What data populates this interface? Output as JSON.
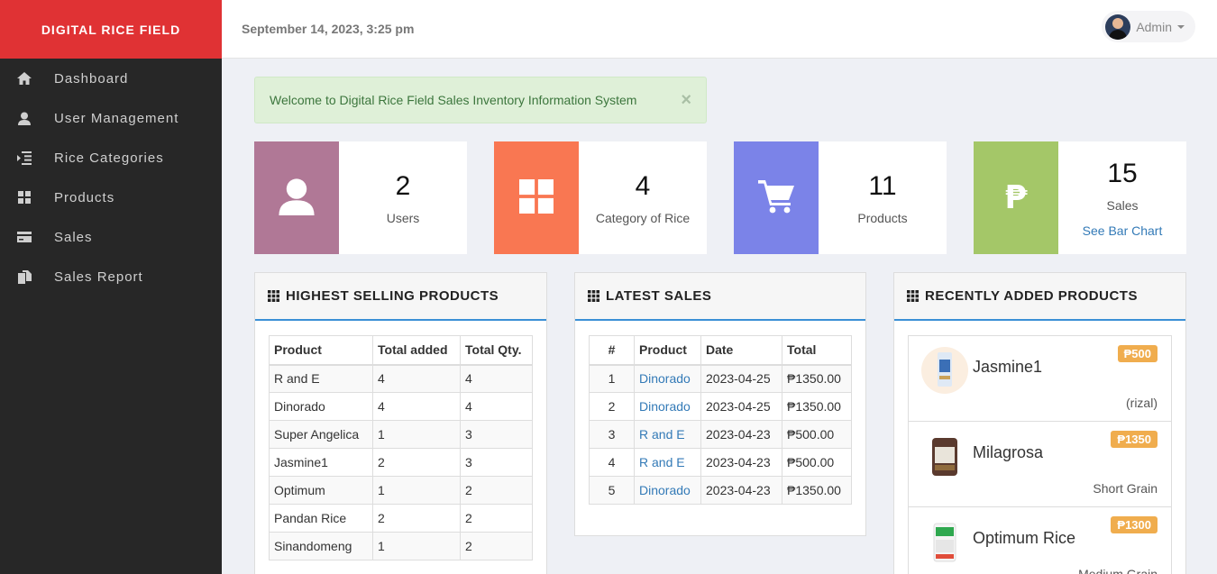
{
  "brand": "DIGITAL RICE FIELD",
  "header": {
    "date": "September 14, 2023, 3:25 pm",
    "user": "Admin"
  },
  "sidebar": {
    "items": [
      {
        "label": "Dashboard",
        "icon": "home-icon"
      },
      {
        "label": "User Management",
        "icon": "user-icon"
      },
      {
        "label": "Rice Categories",
        "icon": "indent-icon"
      },
      {
        "label": "Products",
        "icon": "th-large-icon"
      },
      {
        "label": "Sales",
        "icon": "credit-card-icon"
      },
      {
        "label": "Sales Report",
        "icon": "duplicate-icon"
      }
    ]
  },
  "alert": {
    "message": "Welcome to Digital Rice Field Sales Inventory Information System",
    "close": "×"
  },
  "stats": [
    {
      "value": "2",
      "label": "Users",
      "color": "#b07896",
      "icon": "user-icon"
    },
    {
      "value": "4",
      "label": "Category of Rice",
      "color": "#f97752",
      "icon": "th-large-icon"
    },
    {
      "value": "11",
      "label": "Products",
      "color": "#7b83e8",
      "icon": "shopping-cart-icon"
    },
    {
      "value": "15",
      "label": "Sales",
      "color": "#a4c768",
      "icon": "peso-icon",
      "symbol": "₱",
      "link": "See Bar Chart"
    }
  ],
  "highest_selling": {
    "title": "HIGHEST SELLING PRODUCTS",
    "columns": [
      "Product",
      "Total added",
      "Total Qty."
    ],
    "rows": [
      [
        "R and E",
        "4",
        "4"
      ],
      [
        "Dinorado",
        "4",
        "4"
      ],
      [
        "Super Angelica",
        "1",
        "3"
      ],
      [
        "Jasmine1",
        "2",
        "3"
      ],
      [
        "Optimum",
        "1",
        "2"
      ],
      [
        "Pandan Rice",
        "2",
        "2"
      ],
      [
        "Sinandomeng",
        "1",
        "2"
      ]
    ]
  },
  "latest_sales": {
    "title": "LATEST SALES",
    "columns": [
      "#",
      "Product",
      "Date",
      "Total"
    ],
    "rows": [
      [
        "1",
        "Dinorado",
        "2023-04-25",
        "₱1350.00"
      ],
      [
        "2",
        "Dinorado",
        "2023-04-25",
        "₱1350.00"
      ],
      [
        "3",
        "R and E",
        "2023-04-23",
        "₱500.00"
      ],
      [
        "4",
        "R and E",
        "2023-04-23",
        "₱500.00"
      ],
      [
        "5",
        "Dinorado",
        "2023-04-23",
        "₱1350.00"
      ]
    ]
  },
  "recent_products": {
    "title": "RECENTLY ADDED PRODUCTS",
    "items": [
      {
        "name": "Jasmine1",
        "price": "₱500",
        "category": "(rizal)"
      },
      {
        "name": "Milagrosa",
        "price": "₱1350",
        "category": "Short Grain"
      },
      {
        "name": "Optimum Rice",
        "price": "₱1300",
        "category": "Medium Grain"
      }
    ]
  }
}
